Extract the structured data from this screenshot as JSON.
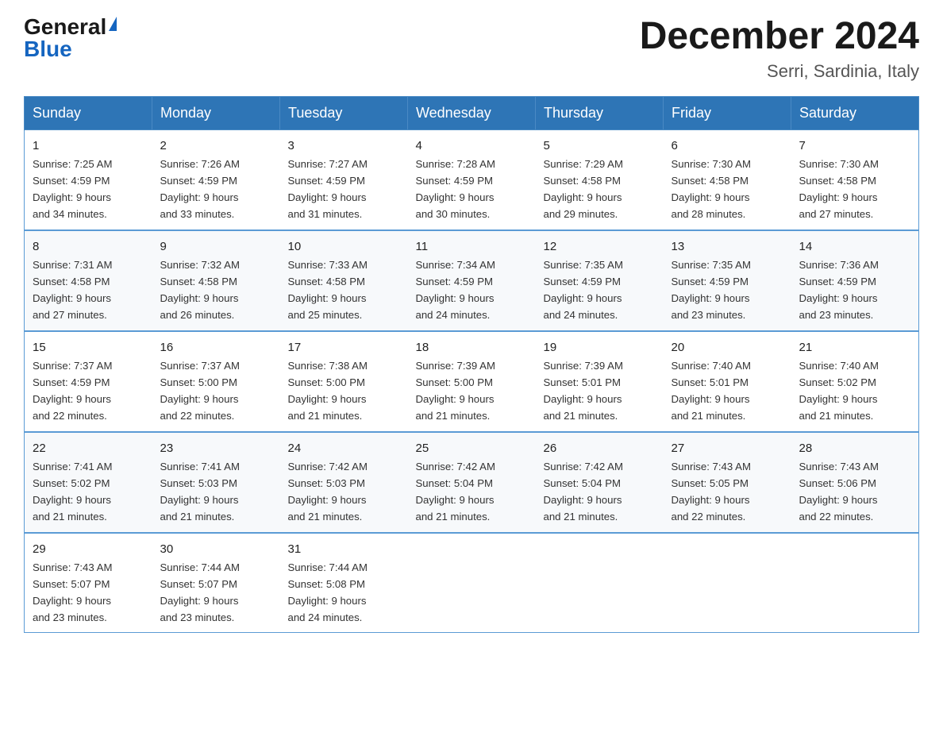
{
  "header": {
    "logo_general": "General",
    "logo_blue": "Blue",
    "month_title": "December 2024",
    "location": "Serri, Sardinia, Italy"
  },
  "days_of_week": [
    "Sunday",
    "Monday",
    "Tuesday",
    "Wednesday",
    "Thursday",
    "Friday",
    "Saturday"
  ],
  "weeks": [
    [
      {
        "day": "1",
        "sunrise": "7:25 AM",
        "sunset": "4:59 PM",
        "daylight": "9 hours and 34 minutes."
      },
      {
        "day": "2",
        "sunrise": "7:26 AM",
        "sunset": "4:59 PM",
        "daylight": "9 hours and 33 minutes."
      },
      {
        "day": "3",
        "sunrise": "7:27 AM",
        "sunset": "4:59 PM",
        "daylight": "9 hours and 31 minutes."
      },
      {
        "day": "4",
        "sunrise": "7:28 AM",
        "sunset": "4:59 PM",
        "daylight": "9 hours and 30 minutes."
      },
      {
        "day": "5",
        "sunrise": "7:29 AM",
        "sunset": "4:58 PM",
        "daylight": "9 hours and 29 minutes."
      },
      {
        "day": "6",
        "sunrise": "7:30 AM",
        "sunset": "4:58 PM",
        "daylight": "9 hours and 28 minutes."
      },
      {
        "day": "7",
        "sunrise": "7:30 AM",
        "sunset": "4:58 PM",
        "daylight": "9 hours and 27 minutes."
      }
    ],
    [
      {
        "day": "8",
        "sunrise": "7:31 AM",
        "sunset": "4:58 PM",
        "daylight": "9 hours and 27 minutes."
      },
      {
        "day": "9",
        "sunrise": "7:32 AM",
        "sunset": "4:58 PM",
        "daylight": "9 hours and 26 minutes."
      },
      {
        "day": "10",
        "sunrise": "7:33 AM",
        "sunset": "4:58 PM",
        "daylight": "9 hours and 25 minutes."
      },
      {
        "day": "11",
        "sunrise": "7:34 AM",
        "sunset": "4:59 PM",
        "daylight": "9 hours and 24 minutes."
      },
      {
        "day": "12",
        "sunrise": "7:35 AM",
        "sunset": "4:59 PM",
        "daylight": "9 hours and 24 minutes."
      },
      {
        "day": "13",
        "sunrise": "7:35 AM",
        "sunset": "4:59 PM",
        "daylight": "9 hours and 23 minutes."
      },
      {
        "day": "14",
        "sunrise": "7:36 AM",
        "sunset": "4:59 PM",
        "daylight": "9 hours and 23 minutes."
      }
    ],
    [
      {
        "day": "15",
        "sunrise": "7:37 AM",
        "sunset": "4:59 PM",
        "daylight": "9 hours and 22 minutes."
      },
      {
        "day": "16",
        "sunrise": "7:37 AM",
        "sunset": "5:00 PM",
        "daylight": "9 hours and 22 minutes."
      },
      {
        "day": "17",
        "sunrise": "7:38 AM",
        "sunset": "5:00 PM",
        "daylight": "9 hours and 21 minutes."
      },
      {
        "day": "18",
        "sunrise": "7:39 AM",
        "sunset": "5:00 PM",
        "daylight": "9 hours and 21 minutes."
      },
      {
        "day": "19",
        "sunrise": "7:39 AM",
        "sunset": "5:01 PM",
        "daylight": "9 hours and 21 minutes."
      },
      {
        "day": "20",
        "sunrise": "7:40 AM",
        "sunset": "5:01 PM",
        "daylight": "9 hours and 21 minutes."
      },
      {
        "day": "21",
        "sunrise": "7:40 AM",
        "sunset": "5:02 PM",
        "daylight": "9 hours and 21 minutes."
      }
    ],
    [
      {
        "day": "22",
        "sunrise": "7:41 AM",
        "sunset": "5:02 PM",
        "daylight": "9 hours and 21 minutes."
      },
      {
        "day": "23",
        "sunrise": "7:41 AM",
        "sunset": "5:03 PM",
        "daylight": "9 hours and 21 minutes."
      },
      {
        "day": "24",
        "sunrise": "7:42 AM",
        "sunset": "5:03 PM",
        "daylight": "9 hours and 21 minutes."
      },
      {
        "day": "25",
        "sunrise": "7:42 AM",
        "sunset": "5:04 PM",
        "daylight": "9 hours and 21 minutes."
      },
      {
        "day": "26",
        "sunrise": "7:42 AM",
        "sunset": "5:04 PM",
        "daylight": "9 hours and 21 minutes."
      },
      {
        "day": "27",
        "sunrise": "7:43 AM",
        "sunset": "5:05 PM",
        "daylight": "9 hours and 22 minutes."
      },
      {
        "day": "28",
        "sunrise": "7:43 AM",
        "sunset": "5:06 PM",
        "daylight": "9 hours and 22 minutes."
      }
    ],
    [
      {
        "day": "29",
        "sunrise": "7:43 AM",
        "sunset": "5:07 PM",
        "daylight": "9 hours and 23 minutes."
      },
      {
        "day": "30",
        "sunrise": "7:44 AM",
        "sunset": "5:07 PM",
        "daylight": "9 hours and 23 minutes."
      },
      {
        "day": "31",
        "sunrise": "7:44 AM",
        "sunset": "5:08 PM",
        "daylight": "9 hours and 24 minutes."
      },
      null,
      null,
      null,
      null
    ]
  ],
  "labels": {
    "sunrise": "Sunrise:",
    "sunset": "Sunset:",
    "daylight": "Daylight:"
  }
}
